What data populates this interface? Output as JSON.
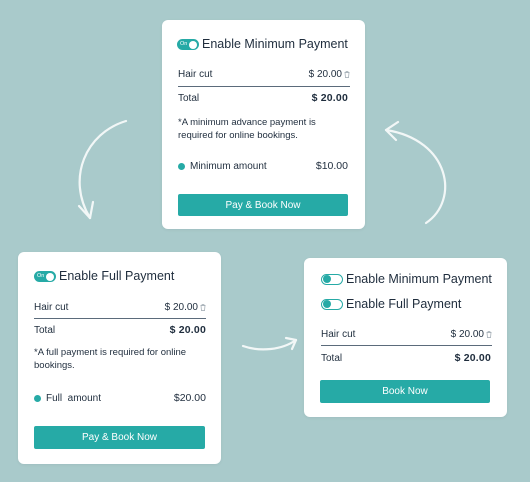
{
  "colors": {
    "background": "#a9cacb",
    "accent": "#26aaa6",
    "card": "#ffffff",
    "text": "#1f2d3d"
  },
  "cards": {
    "minimum": {
      "toggle": {
        "state": "on",
        "on_text": "On",
        "label": "Enable Minimum Payment"
      },
      "item": {
        "name": "Hair cut",
        "price": "$ 20.00"
      },
      "total": {
        "label": "Total",
        "value": "$ 20.00"
      },
      "note": "*A minimum advance payment is required for online bookings.",
      "amount": {
        "label": "Minimum amount",
        "value": "$10.00"
      },
      "button_label": "Pay & Book Now"
    },
    "full": {
      "toggle": {
        "state": "on",
        "on_text": "On",
        "label": "Enable Full Payment"
      },
      "item": {
        "name": "Hair cut",
        "price": "$ 20.00"
      },
      "total": {
        "label": "Total",
        "value": "$ 20.00"
      },
      "note": "*A full payment is required for online bookings.",
      "amount": {
        "label": "Full  amount",
        "value": "$20.00"
      },
      "button_label": "Pay & Book Now"
    },
    "none": {
      "toggles": [
        {
          "state": "off",
          "label": "Enable Minimum Payment"
        },
        {
          "state": "off",
          "label": "Enable Full Payment"
        }
      ],
      "item": {
        "name": "Hair cut",
        "price": "$ 20.00"
      },
      "total": {
        "label": "Total",
        "value": "$ 20.00"
      },
      "button_label": "Book Now"
    }
  },
  "icons": [
    "trash-icon",
    "toggle-switch",
    "curved-arrow-icon"
  ]
}
